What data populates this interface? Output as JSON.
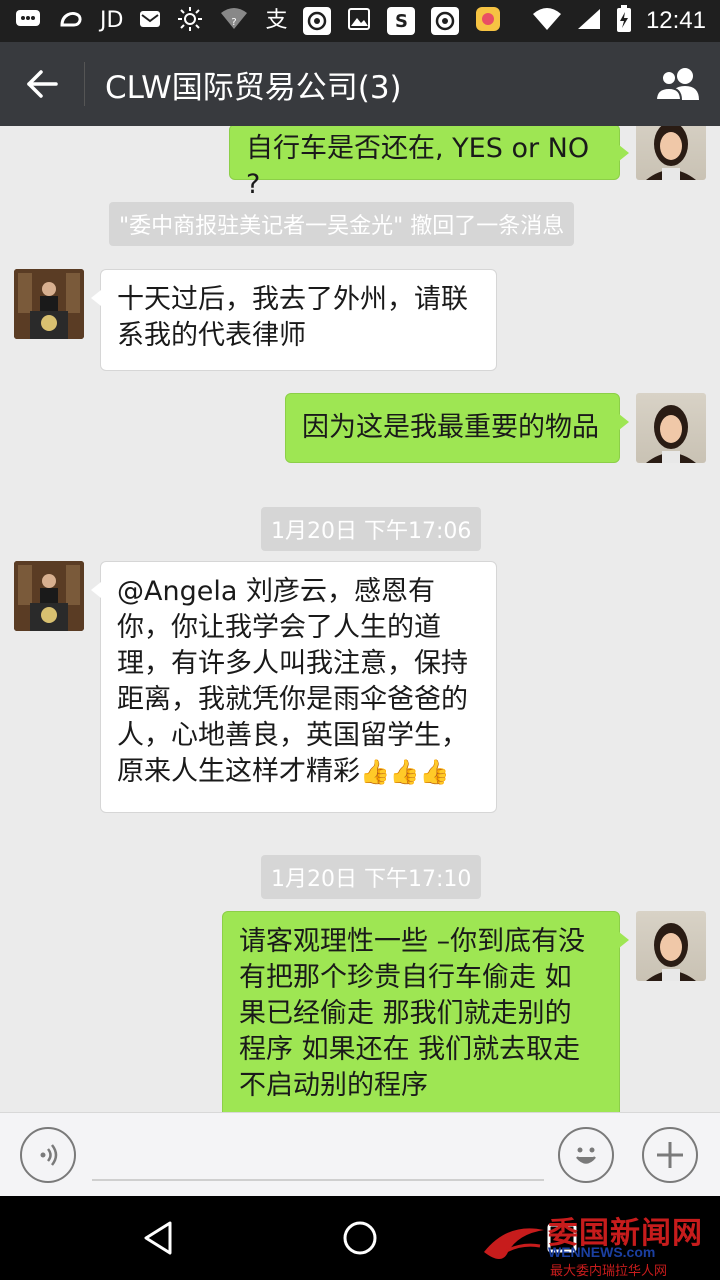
{
  "status_bar": {
    "left_icons": [
      "message-icon",
      "uc-browser-icon",
      "jd-icon",
      "mail-icon",
      "brightness-icon",
      "wifi-question-icon",
      "alipay-icon",
      "weibo-icon",
      "image-icon",
      "sogou-icon",
      "weibo-icon-2",
      "app-store-icon"
    ],
    "jd_text": "JD",
    "alipay_text": "支",
    "time": "12:41"
  },
  "header": {
    "title": "CLW国际贸易公司(3)"
  },
  "messages": [
    {
      "id": "m1",
      "direction": "out",
      "sender_avatar": "woman",
      "text": "自行车是否还在, YES  or NO ?"
    },
    {
      "id": "sys1",
      "type": "system",
      "text": "\"委中商报驻美记者一吴金光\" 撤回了一条消息"
    },
    {
      "id": "m2",
      "direction": "in",
      "sender_avatar": "man",
      "lines": [
        "十天过后，我去了外州，请联",
        "系我的代表律师"
      ]
    },
    {
      "id": "m3",
      "direction": "out",
      "sender_avatar": "woman",
      "text": "因为这是我最重要的物品"
    },
    {
      "id": "t1",
      "type": "timestamp",
      "text": "1月20日 下午17:06"
    },
    {
      "id": "m4",
      "direction": "in",
      "sender_avatar": "man",
      "lines": [
        "@Angela 刘彦云，感恩有",
        "你，你让我学会了人生的道",
        "理，有许多人叫我注意，保持",
        "距离，我就凭你是雨伞爸爸的",
        "人，心地善良，英国留学生，",
        "原来人生这样才精彩"
      ],
      "emoji": "👍👍👍"
    },
    {
      "id": "t2",
      "type": "timestamp",
      "text": "1月20日 下午17:10"
    },
    {
      "id": "m5",
      "direction": "out",
      "sender_avatar": "woman",
      "lines": [
        "请客观理性一些 –你到底有没",
        "有把那个珍贵自行车偷走 如",
        "果已经偷走 那我们就走别的",
        "程序 如果还在 我们就去取走",
        "不启动别的程序"
      ]
    }
  ],
  "watermark": {
    "title": "委国新闻网",
    "url": "WENNEWS.com",
    "subtitle": "最大委内瑞拉华人网"
  },
  "colors": {
    "outgoing_bubble": "#9ee653",
    "incoming_bubble": "#ffffff",
    "title_bar": "#383a3e",
    "chat_background": "#ebebeb"
  }
}
